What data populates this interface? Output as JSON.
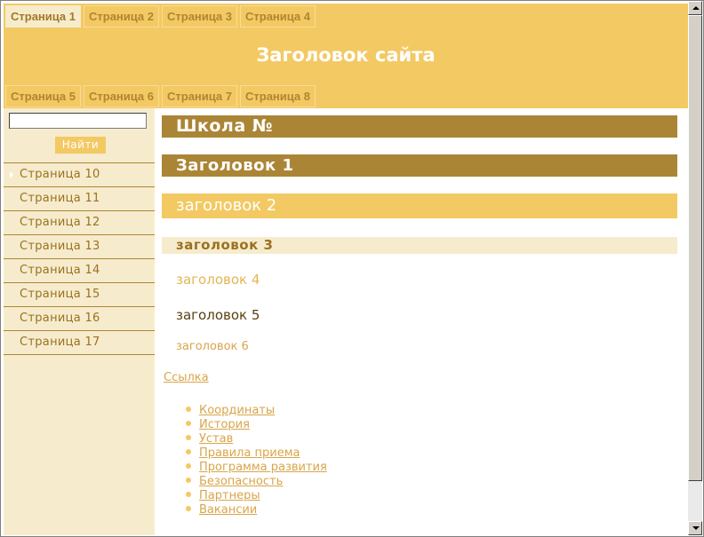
{
  "header": {
    "site_title": "Заголовок сайта",
    "top_tabs": [
      {
        "label": "Страница 1",
        "active": true
      },
      {
        "label": "Страница 2",
        "active": false
      },
      {
        "label": "Страница 3",
        "active": false
      },
      {
        "label": "Страница 4",
        "active": false
      }
    ],
    "bottom_tabs": [
      {
        "label": "Страница 5"
      },
      {
        "label": "Страница 6"
      },
      {
        "label": "Страница 7"
      },
      {
        "label": "Страница 8"
      }
    ]
  },
  "sidebar": {
    "search": {
      "value": "",
      "button_label": "Найти"
    },
    "items": [
      {
        "label": "Страница 10",
        "current": true
      },
      {
        "label": "Страница 11"
      },
      {
        "label": "Страница 12"
      },
      {
        "label": "Страница 13"
      },
      {
        "label": "Страница 14"
      },
      {
        "label": "Страница 15"
      },
      {
        "label": "Страница 16"
      },
      {
        "label": "Страница 17"
      }
    ]
  },
  "content": {
    "school_title": "Школа №",
    "h1": "Заголовок 1",
    "h2": "заголовок 2",
    "h3": "заголовок 3",
    "h4": "заголовок 4",
    "h5": "заголовок 5",
    "h6": "заголовок 6",
    "link": "Ссылка",
    "links": [
      "Координаты",
      "История",
      "Устав",
      "Правила приема",
      "Программа развития",
      "Безопасность",
      "Партнеры",
      "Вакансии"
    ]
  },
  "colors": {
    "header_bg": "#f3c963",
    "dark_bar": "#ab8536",
    "sidebar_bg": "#f6eccd",
    "link": "#d9a54a"
  }
}
